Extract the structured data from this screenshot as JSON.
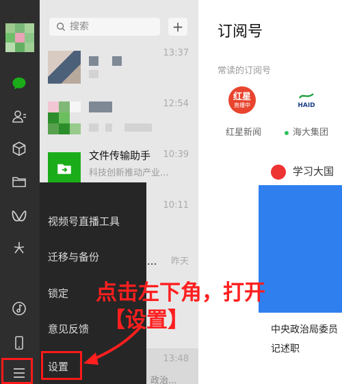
{
  "search": {
    "placeholder": "搜索"
  },
  "chats": [
    {
      "time": "13:37",
      "title": "",
      "preview": ""
    },
    {
      "time": "12:54",
      "title": "",
      "preview": ""
    },
    {
      "time": "10:39",
      "title": "文件传输助手",
      "preview": "科技创新推动产业..."
    },
    {
      "time": "10:11",
      "title": "",
      "preview": ""
    },
    {
      "time": "昨天",
      "title": "园...",
      "preview": ""
    },
    {
      "time": "13:48",
      "title": "",
      "preview": "政治..."
    }
  ],
  "menu": {
    "items": [
      "视频号直播工具",
      "迁移与备份",
      "锁定",
      "意见反馈",
      "设置"
    ]
  },
  "pane": {
    "title": "订阅号",
    "section": "常读的订阅号",
    "accounts": [
      {
        "name": "红星新闻",
        "logo_text": "红星",
        "badge": "直播中"
      },
      {
        "name": "海大集团",
        "logo_text": "HAID"
      }
    ],
    "feed": {
      "source": "学习大国",
      "headline": "中央政治局委员",
      "subline": "记述职"
    }
  },
  "annotation": {
    "line1": "点击左下角，打开",
    "line2": "【设置】"
  },
  "colors": {
    "rail": "#2e2e2e",
    "menu": "#262626",
    "chat_green": "#1aad19",
    "annotation_red": "#ff1f1f",
    "feed_blue": "#2f80ee"
  },
  "icons": [
    "chat-icon",
    "contacts-icon",
    "cube-icon",
    "folder-icon",
    "butterfly-icon",
    "sparkle-icon",
    "music-icon",
    "phone-icon",
    "menu-icon",
    "search-icon",
    "plus-icon"
  ]
}
